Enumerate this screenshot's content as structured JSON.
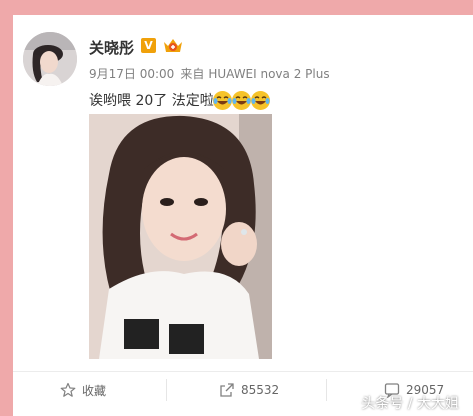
{
  "post": {
    "author": "关晓彤",
    "verified_badge": "V",
    "date": "9月17日 00:00",
    "source_prefix": "来自",
    "source_device": "HUAWEI nova 2 Plus",
    "text": "诶哟喂 20了 法定啦",
    "emoji_count": 3,
    "emoji_name": "laughing-tears-emoji"
  },
  "actions": {
    "favorite_label": "收藏",
    "repost_count": "85532",
    "comment_count": "29057"
  },
  "watermark": "头条号 / 大大姐",
  "colors": {
    "frame": "#efa9aa",
    "card": "#ffffff",
    "badge": "#f0a10a",
    "meta_text": "#808080"
  }
}
